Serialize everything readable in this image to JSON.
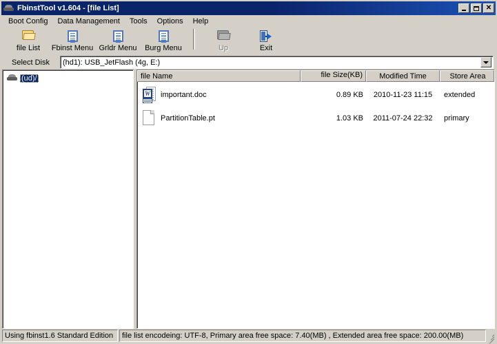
{
  "window": {
    "title": "FbinstTool v1.604 - [file List]",
    "icon": "disk-drive-icon",
    "buttons": {
      "minimize": "_",
      "maximize": "□",
      "close": "✕"
    }
  },
  "menubar": {
    "items": [
      {
        "label": "Boot Config"
      },
      {
        "label": "Data Management"
      },
      {
        "label": "Tools"
      },
      {
        "label": "Options"
      },
      {
        "label": "Help"
      }
    ]
  },
  "toolbar": {
    "items": [
      {
        "label": "file List",
        "icon": "folder-icon",
        "enabled": true
      },
      {
        "label": "Fbinst Menu",
        "icon": "document-icon",
        "enabled": true
      },
      {
        "label": "Grldr Menu",
        "icon": "document-icon",
        "enabled": true
      },
      {
        "label": "Burg Menu",
        "icon": "document-icon",
        "enabled": true
      }
    ],
    "items_right": [
      {
        "label": "Up",
        "icon": "folder-up-icon",
        "enabled": false
      },
      {
        "label": "Exit",
        "icon": "exit-door-icon",
        "enabled": true
      }
    ]
  },
  "select_disk": {
    "label": "Select Disk",
    "value": "(hd1): USB_JetFlash (4g, E:)",
    "dropdown_icon": "chevron-down-icon"
  },
  "tree": {
    "nodes": [
      {
        "label": "(ud)/",
        "icon": "disk-drive-icon",
        "selected": true
      }
    ]
  },
  "file_list": {
    "columns": [
      {
        "key": "name",
        "label": "file Name"
      },
      {
        "key": "size",
        "label": "file Size(KB)"
      },
      {
        "key": "time",
        "label": "Modified Time"
      },
      {
        "key": "area",
        "label": "Store Area"
      }
    ],
    "rows": [
      {
        "icon": "word-document-icon",
        "name": "important.doc",
        "size": "0.89 KB",
        "time": "2010-11-23 11:15",
        "area": "extended"
      },
      {
        "icon": "generic-file-icon",
        "name": "PartitionTable.pt",
        "size": "1.03 KB",
        "time": "2011-07-24 22:32",
        "area": "primary"
      }
    ]
  },
  "statusbar": {
    "left": "Using fbinst1.6 Standard Edition",
    "right": "file list encodeing: UTF-8, Primary area free space: 7.40(MB) ,  Extended area free space: 200.00(MB)"
  },
  "colors": {
    "title_start": "#0a246a",
    "title_end": "#1c52b5",
    "face": "#d4d0c8",
    "selection": "#0a246a",
    "field": "#ffffff"
  }
}
